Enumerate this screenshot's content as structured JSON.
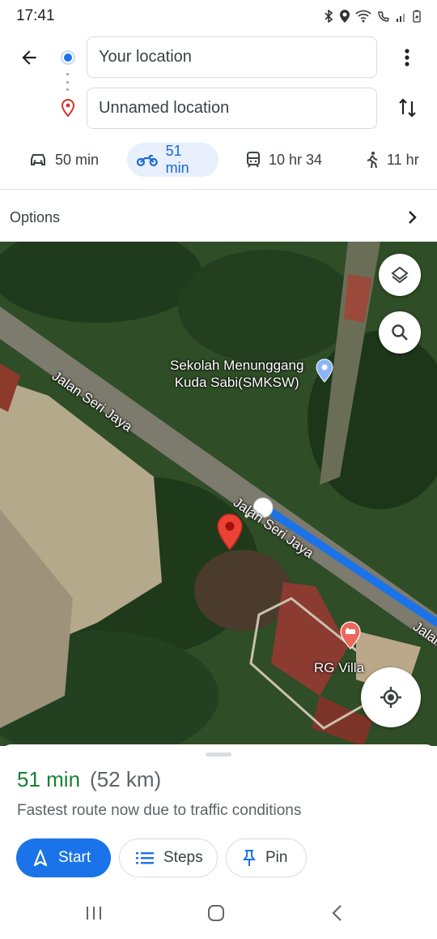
{
  "status_bar": {
    "time": "17:41"
  },
  "directions": {
    "origin_text": "Your location",
    "destination_text": "Unnamed location"
  },
  "travel_modes": [
    {
      "mode": "car",
      "label": "50 min",
      "selected": false
    },
    {
      "mode": "motorcycle",
      "label": "51 min",
      "selected": true
    },
    {
      "mode": "transit",
      "label": "10 hr 34",
      "selected": false
    },
    {
      "mode": "walking",
      "label": "11 hr",
      "selected": false
    }
  ],
  "options_label": "Options",
  "map": {
    "poi_school": "Sekolah Menunggang\nKuda Sabi(SMKSW)",
    "poi_villa": "RG Villa",
    "street_name_1": "Jalan Seri Jaya",
    "street_name_2": "Jalan Seri Jaya",
    "street_name_3": "Jalan"
  },
  "route_summary": {
    "duration": "51 min",
    "distance": "(52 km)",
    "description": "Fastest route now due to traffic conditions"
  },
  "actions": {
    "start_label": "Start",
    "steps_label": "Steps",
    "pin_label": "Pin"
  },
  "colors": {
    "accent_blue": "#1a73e8",
    "eta_green": "#188038",
    "active_mode_bg": "#e8f0fe",
    "route_blue": "#1a73e8",
    "pin_red": "#ea4335"
  },
  "icons": {
    "back": "arrow-left-icon",
    "more": "more-vert-icon",
    "swap": "swap-vert-icon",
    "layers": "layers-icon",
    "search": "search-icon",
    "location": "my-location-icon"
  }
}
